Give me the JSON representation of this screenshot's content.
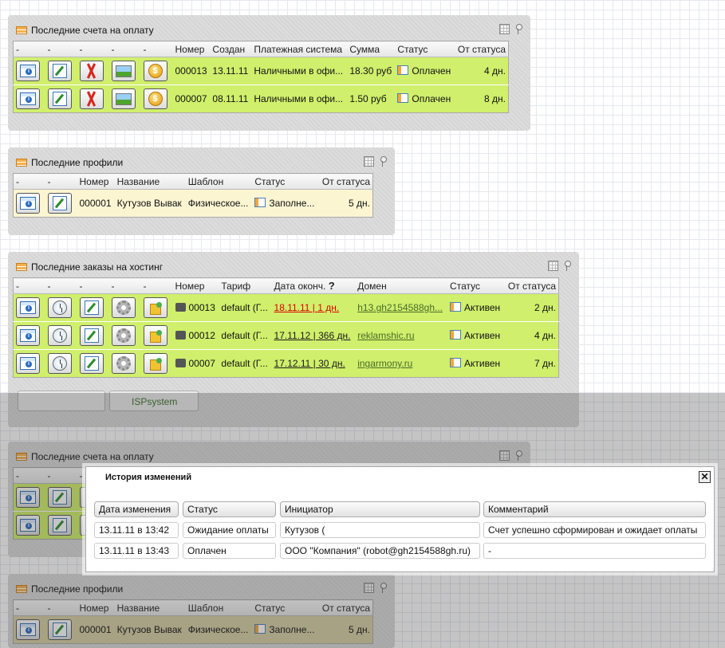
{
  "invoices_title": "Последние счета на оплату",
  "invoices": {
    "headers": [
      "-",
      "-",
      "-",
      "-",
      "-",
      "Номер",
      "Создан",
      "Платежная система",
      "Сумма",
      "Статус",
      "От статуса"
    ],
    "rows": [
      {
        "number": "000013",
        "created": "13.11.11",
        "system": "Наличными в офи...",
        "sum": "18.30 руб",
        "status": "Оплачен",
        "age": "4 дн."
      },
      {
        "number": "000007",
        "created": "08.11.11",
        "system": "Наличными в офи...",
        "sum": "1.50 руб",
        "status": "Оплачен",
        "age": "8 дн."
      }
    ]
  },
  "profiles_title": "Последние профили",
  "profiles": {
    "headers": [
      "-",
      "-",
      "Номер",
      "Название",
      "Шаблон",
      "Статус",
      "От статуса"
    ],
    "rows": [
      {
        "number": "000001",
        "name": "Кутузов Вывак",
        "template": "Физическое...",
        "status": "Заполне...",
        "age": "5 дн."
      }
    ]
  },
  "hosting_title": "Последние заказы на хостинг",
  "hosting": {
    "headers": [
      "-",
      "-",
      "-",
      "-",
      "-",
      "Номер",
      "Тариф",
      "Дата оконч.",
      "Домен",
      "Статус",
      "От статуса"
    ],
    "help_mark": "?",
    "rows": [
      {
        "number": "00013",
        "tariff": "default (Г...",
        "end": "18.11.11 | 1 дн.",
        "domain": "h13.gh2154588gh...",
        "status": "Активен",
        "age": "2 дн."
      },
      {
        "number": "00012",
        "tariff": "default (Г...",
        "end": "17.11.12 | 366 дн.",
        "domain": "reklamshic.ru",
        "status": "Активен",
        "age": "4 дн."
      },
      {
        "number": "00007",
        "tariff": "default (Г...",
        "end": "17.12.11 | 30 дн.",
        "domain": "ingarmony.ru",
        "status": "Активен",
        "age": "7 дн."
      }
    ]
  },
  "partial_link": "ISPsystem",
  "dialog": {
    "title": "История изменений",
    "close": "✕",
    "headers": [
      "Дата изменения",
      "Статус",
      "Инициатор",
      "Комментарий"
    ],
    "rows": [
      {
        "date": "13.11.11 в 13:42",
        "status": "Ожидание оплаты",
        "initiator": "Кутузов (",
        "comment": "Счет успешно сформирован и ожидает оплаты"
      },
      {
        "date": "13.11.11 в 13:43",
        "status": "Оплачен",
        "initiator": "ООО \"Компания\" (robot@gh2154588gh.ru)",
        "comment": "-"
      }
    ]
  },
  "icons": [
    "info-icon",
    "edit-icon",
    "pdf-icon",
    "image-icon",
    "coin-icon",
    "clock-icon",
    "gear-icon",
    "puzzle-icon",
    "status-icon",
    "server-icon"
  ],
  "colors": {
    "row_green": "#d0ef6c",
    "row_cream": "#fbf5d2",
    "expired_red": "#d00000"
  }
}
